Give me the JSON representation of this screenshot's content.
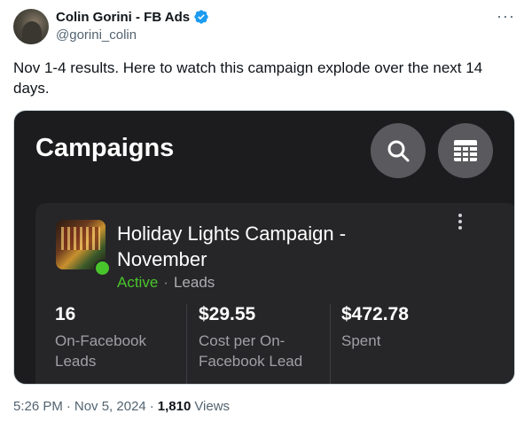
{
  "author": {
    "display_name": "Colin Gorini - FB Ads",
    "handle": "@gorini_colin"
  },
  "tweet": {
    "text": "Nov 1-4 results. Here to watch this campaign explode over the next 14 days."
  },
  "media": {
    "header_title": "Campaigns",
    "campaign": {
      "name": "Holiday Lights Campaign - November",
      "status": "Active",
      "separator": "·",
      "objective": "Leads",
      "metrics": [
        {
          "value": "16",
          "label": "On-Facebook Leads"
        },
        {
          "value": "$29.55",
          "label": "Cost per On-Facebook Lead"
        },
        {
          "value": "$472.78",
          "label": "Spent"
        }
      ]
    }
  },
  "footer": {
    "time": "5:26 PM",
    "dot1": "·",
    "date": "Nov 5, 2024",
    "dot2": "·",
    "views_count": "1,810",
    "views_label": "Views"
  },
  "colors": {
    "active": "#49c52c",
    "verified": "#1d9bf0",
    "panel_bg": "#1c1c1e"
  },
  "icons": [
    "verified-badge-icon",
    "more-icon",
    "search-icon",
    "table-icon",
    "kebab-menu-icon"
  ]
}
